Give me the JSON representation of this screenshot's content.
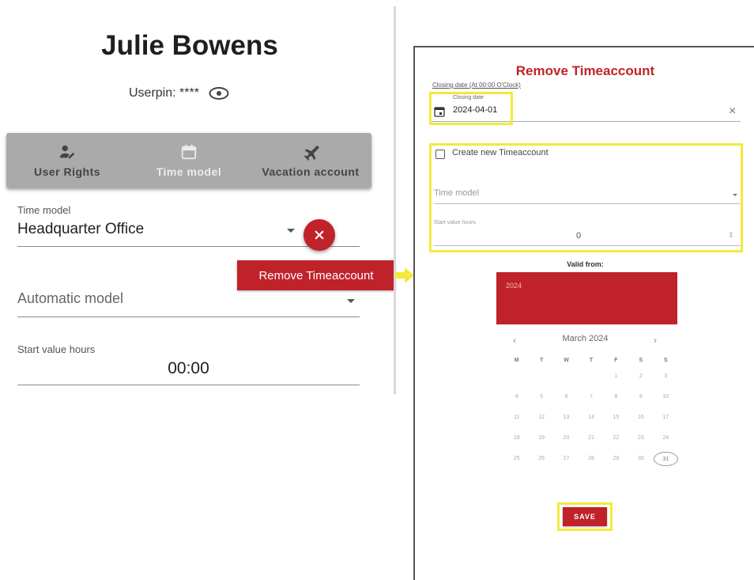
{
  "user": {
    "name": "Julie Bowens",
    "userpin_label": "Userpin: ****"
  },
  "tabs": [
    {
      "label": "User Rights",
      "icon": "user-edit-icon",
      "active": false
    },
    {
      "label": "Time model",
      "icon": "calendar-icon",
      "active": true
    },
    {
      "label": "Vacation account",
      "icon": "airplane-icon",
      "active": false
    }
  ],
  "form": {
    "time_model_label": "Time model",
    "time_model_value": "Headquarter Office",
    "automatic_model_value": "Automatic model",
    "start_value_label": "Start value hours",
    "start_value": "00:00"
  },
  "tooltip": {
    "text": "Remove Timeaccount"
  },
  "dialog": {
    "title": "Remove Timeaccount",
    "closing_caption": "Closing date (At 00:00 O'Clock)",
    "closing_inner_label": "Closing date",
    "closing_value": "2024-04-01",
    "clear_symbol": "×",
    "create_label": "Create new Timeaccount",
    "time_model_placeholder": "Time model",
    "start_value_label": "Start value hours",
    "start_value": "0",
    "valid_from_label": "Valid from:",
    "calendar": {
      "year": "2024",
      "month_label": "March 2024",
      "prev": "‹",
      "next": "›",
      "weekdays": [
        "M",
        "T",
        "W",
        "T",
        "F",
        "S",
        "S"
      ],
      "weeks": [
        [
          "",
          "",
          "",
          "",
          "1",
          "2",
          "3"
        ],
        [
          "4",
          "5",
          "6",
          "7",
          "8",
          "9",
          "10"
        ],
        [
          "11",
          "12",
          "13",
          "14",
          "15",
          "16",
          "17"
        ],
        [
          "18",
          "19",
          "20",
          "21",
          "22",
          "23",
          "24"
        ],
        [
          "25",
          "26",
          "27",
          "28",
          "29",
          "30",
          "31"
        ]
      ],
      "selected_day": "31"
    },
    "save_label": "SAVE"
  },
  "colors": {
    "accent_red": "#c0222a",
    "highlight_yellow": "#f3ea3a",
    "tabbar_gray": "#aaaaaa"
  }
}
